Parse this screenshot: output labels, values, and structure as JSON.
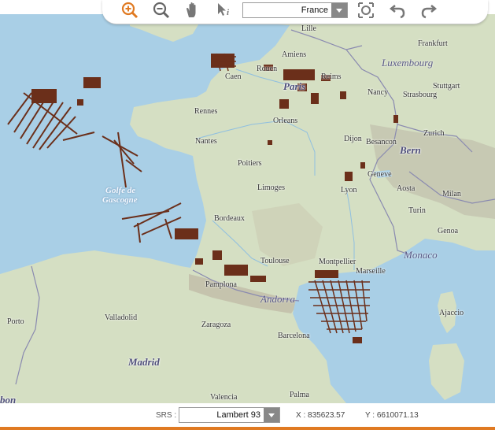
{
  "toolbar": {
    "tools": [
      {
        "name": "zoom-in-icon",
        "active": true
      },
      {
        "name": "zoom-out-icon"
      },
      {
        "name": "pan-hand-icon"
      },
      {
        "name": "info-pointer-icon"
      },
      {
        "name": "zoom-extent-icon"
      },
      {
        "name": "undo-icon"
      },
      {
        "name": "redo-icon"
      }
    ],
    "zone_value": "France",
    "accent_color": "#e07a22"
  },
  "map": {
    "labels": {
      "lille": "Lille",
      "amiens": "Amiens",
      "frankfurt": "Frankfurt",
      "luxembourg": "Luxembourg",
      "rouen": "Rouen",
      "caen": "Caen",
      "paris": "Paris",
      "reims": "Reims",
      "stuttgart": "Stuttgart",
      "nancy": "Nancy",
      "strasbourg": "Strasbourg",
      "rennes": "Rennes",
      "orleans": "Orleans",
      "zurich": "Zurich",
      "dijon": "Dijon",
      "besancon": "Besancon",
      "bern": "Bern",
      "nantes": "Nantes",
      "poitiers": "Poitiers",
      "geneve": "Geneve",
      "aosta": "Aosta",
      "milan": "Milan",
      "golfe1": "Golfe de",
      "golfe2": "Gascogne",
      "limoges": "Limoges",
      "lyon": "Lyon",
      "turin": "Turin",
      "bordeaux": "Bordeaux",
      "genoa": "Genoa",
      "monaco": "Monaco",
      "toulouse": "Toulouse",
      "montpellier": "Montpellier",
      "marseille": "Marseille",
      "pamplona": "Pamplona",
      "andorra": "Andorra",
      "porto": "Porto",
      "valladolid": "Valladolid",
      "zaragoza": "Zaragoza",
      "ajaccio": "Ajaccio",
      "barcelona": "Barcelona",
      "madrid": "Madrid",
      "valencia": "Valencia",
      "palma": "Palma",
      "lisbon_partial": "bon"
    }
  },
  "status": {
    "srs_label": "SRS :",
    "srs_value": "Lambert 93",
    "x_label": "X : 835623.57",
    "y_label": "Y : 6610071.13"
  }
}
